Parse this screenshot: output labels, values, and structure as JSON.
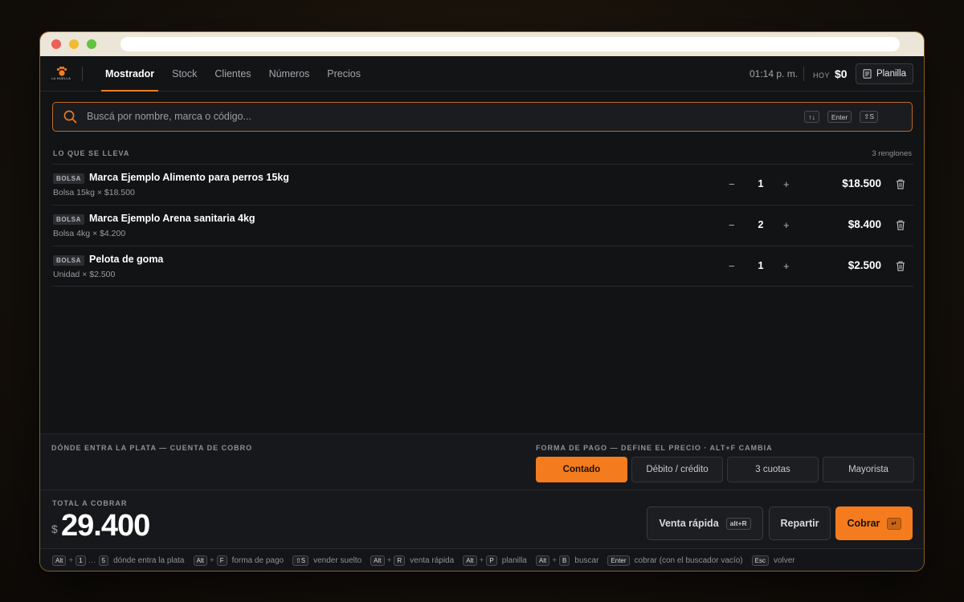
{
  "app": {
    "brand_text": "LA HUELLA",
    "accent_color": "#f47c1e"
  },
  "nav": {
    "tabs": [
      {
        "label": "Mostrador",
        "active": true
      },
      {
        "label": "Stock"
      },
      {
        "label": "Clientes"
      },
      {
        "label": "Números"
      },
      {
        "label": "Precios"
      }
    ],
    "clock": "01:14 p. m.",
    "hoy_label": "HOY",
    "hoy_value": "$0",
    "planilla_label": "Planilla"
  },
  "search": {
    "placeholder": "Buscá por nombre, marca o código...",
    "value": "",
    "kbd_arrows": "↑↓",
    "kbd_enter": "Enter",
    "kbd_s": "⇧S"
  },
  "cart": {
    "title": "LO QUE SE LLEVA",
    "count_label": "3 renglones",
    "items": [
      {
        "badge": "BOLSA",
        "name": "Marca Ejemplo Alimento para perros 15kg",
        "sub": "Bolsa 15kg × $18.500",
        "qty": "1",
        "price": "$18.500"
      },
      {
        "badge": "BOLSA",
        "name": "Marca Ejemplo Arena sanitaria 4kg",
        "sub": "Bolsa 4kg × $4.200",
        "qty": "2",
        "price": "$8.400"
      },
      {
        "badge": "BOLSA",
        "name": "Pelota de goma",
        "sub": "Unidad × $2.500",
        "qty": "1",
        "price": "$2.500"
      }
    ],
    "minus": "−",
    "plus": "+"
  },
  "payment": {
    "donde_title": "DÓNDE ENTRA LA PLATA — CUENTA DE COBRO",
    "forma_title": "FORMA DE PAGO — DEFINE EL PRECIO · ALT+F CAMBIA",
    "options": [
      {
        "label": "Contado",
        "active": true
      },
      {
        "label": "Débito / crédito"
      },
      {
        "label": "3 cuotas"
      },
      {
        "label": "Mayorista"
      }
    ]
  },
  "total": {
    "label": "TOTAL A COBRAR",
    "currency": "$",
    "value": "29.400"
  },
  "actions": {
    "venta_rapida": "Venta rápida",
    "venta_rapida_kbd": "alt+R",
    "repartir": "Repartir",
    "cobrar": "Cobrar",
    "cobrar_kbd": "↵"
  },
  "shortcuts": {
    "s1": {
      "k1": "Alt",
      "k2": "1",
      "mid": "…",
      "k3": "5",
      "desc": "dónde entra la plata"
    },
    "s2": {
      "k1": "Alt",
      "k2": "F",
      "desc": "forma de pago"
    },
    "s3": {
      "k1": "⇧S",
      "desc": "vender suelto"
    },
    "s4": {
      "k1": "Alt",
      "k2": "R",
      "desc": "venta rápida"
    },
    "s5": {
      "k1": "Alt",
      "k2": "P",
      "desc": "planilla"
    },
    "s6": {
      "k1": "Alt",
      "k2": "B",
      "desc": "buscar"
    },
    "s7": {
      "k1": "Enter",
      "desc": "cobrar (con el buscador vacío)"
    },
    "s8": {
      "k1": "Esc",
      "desc": "volver"
    },
    "plus": "+"
  }
}
